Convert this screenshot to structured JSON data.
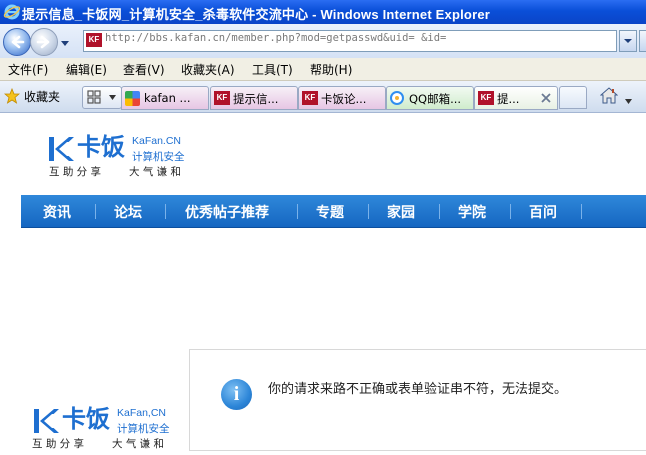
{
  "window": {
    "title": "提示信息_卡饭网_计算机安全_杀毒软件交流中心 - Windows Internet Explorer"
  },
  "address_bar": {
    "url": "http://bbs.kafan.cn/member.php?mod=getpasswd&uid=        &id="
  },
  "menu": {
    "items": [
      "文件(F)",
      "编辑(E)",
      "查看(V)",
      "收藏夹(A)",
      "工具(T)",
      "帮助(H)"
    ]
  },
  "favorites_bar": {
    "label": "收藏夹"
  },
  "tabs": [
    {
      "label": "kafan ...",
      "icon": "google-icon"
    },
    {
      "label": "提示信...",
      "icon": "kafan-favicon"
    },
    {
      "label": "卡饭论...",
      "icon": "kafan-favicon"
    },
    {
      "label": "QQ邮箱...",
      "icon": "qq-mail-icon"
    },
    {
      "label": "提...",
      "icon": "kafan-favicon",
      "active": true
    }
  ],
  "favicon_text": "KF",
  "logo": {
    "name": "卡饭",
    "domain": "KaFan.CN",
    "category": "计算机安全",
    "slogan_left": "互 助 分 享",
    "slogan_right": "大 气 谦 和"
  },
  "logo_footer": {
    "domain": "KaFan,CN"
  },
  "site_nav": {
    "items": [
      "资讯",
      "论坛",
      "优秀帖子推荐",
      "专题",
      "家园",
      "学院",
      "百问"
    ]
  },
  "message": {
    "text": "你的请求来路不正确或表单验证串不符，无法提交。",
    "icon": "info-icon",
    "icon_glyph": "i"
  },
  "colors": {
    "titlebar": "#0a4fd8",
    "nav_blue": "#1f74cc",
    "brand": "#1e6fd0"
  }
}
